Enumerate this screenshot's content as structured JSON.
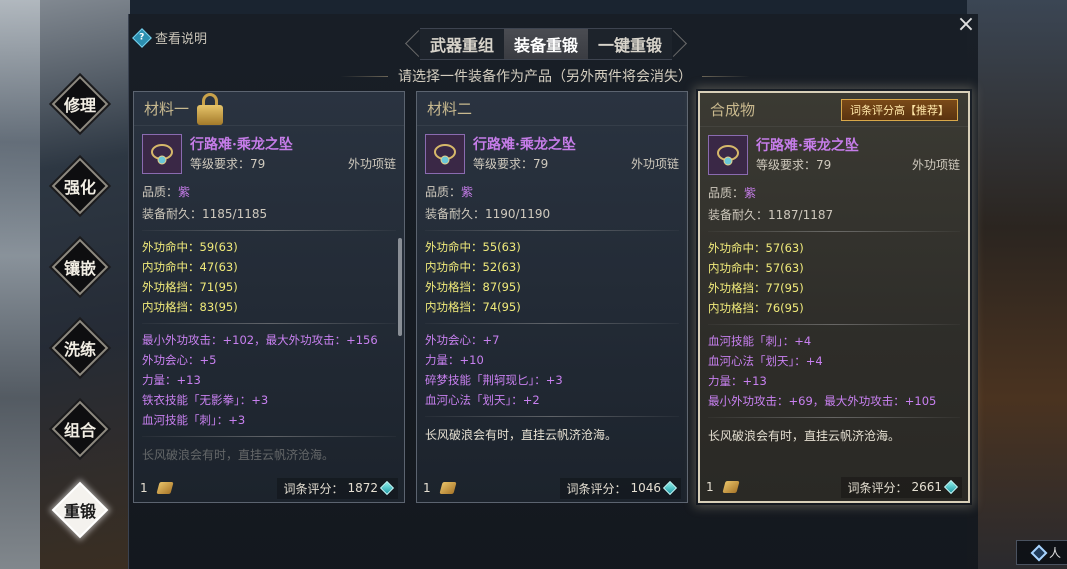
{
  "header": {
    "help_label": "查看说明",
    "close_symbol": "×",
    "subtitle": "请选择一件装备作为产品（另外两件将会消失）"
  },
  "tabs": [
    {
      "label": "武器重组",
      "active": false
    },
    {
      "label": "装备重锻",
      "active": true
    },
    {
      "label": "一键重锻",
      "active": false
    }
  ],
  "side_menu": [
    {
      "label": "修理",
      "active": false
    },
    {
      "label": "强化",
      "active": false
    },
    {
      "label": "镶嵌",
      "active": false
    },
    {
      "label": "洗练",
      "active": false
    },
    {
      "label": "组合",
      "active": false
    },
    {
      "label": "重锻",
      "active": true
    }
  ],
  "cards": [
    {
      "title": "材料一",
      "locked": true,
      "item_name": "行路难·乘龙之坠",
      "level_req": "等级要求：79",
      "item_type": "外功项链",
      "quality_label": "品质：",
      "quality_value": "紫",
      "durability": "装备耐久：1185/1185",
      "stats": [
        "外功命中：59(63)",
        "内功命中：47(63)",
        "外功格挡：71(95)",
        "内功格挡：83(95)"
      ],
      "affixes": [
        "最小外功攻击：+102，最大外功攻击：+156",
        "外功会心：+5",
        "力量：+13",
        "铁衣技能「无影拳」：+3",
        "血河技能「刺」：+3"
      ],
      "flavor": "长风破浪会有时，直挂云帆济沧海。",
      "count": "1",
      "score_label": "词条评分：",
      "score": "1872"
    },
    {
      "title": "材料二",
      "locked": false,
      "item_name": "行路难·乘龙之坠",
      "level_req": "等级要求：79",
      "item_type": "外功项链",
      "quality_label": "品质：",
      "quality_value": "紫",
      "durability": "装备耐久：1190/1190",
      "stats": [
        "外功命中：55(63)",
        "内功命中：52(63)",
        "外功格挡：87(95)",
        "内功格挡：74(95)"
      ],
      "affixes": [
        "外功会心：+7",
        "力量：+10",
        "碎梦技能「荆轲现匕」：+3",
        "血河心法「划天」：+2"
      ],
      "flavor": "长风破浪会有时，直挂云帆济沧海。",
      "count": "1",
      "score_label": "词条评分：",
      "score": "1046"
    },
    {
      "title": "合成物",
      "badge": "词条评分高【推荐】",
      "locked": false,
      "item_name": "行路难·乘龙之坠",
      "level_req": "等级要求：79",
      "item_type": "外功项链",
      "quality_label": "品质：",
      "quality_value": "紫",
      "durability": "装备耐久：1187/1187",
      "stats": [
        "外功命中：57(63)",
        "内功命中：57(63)",
        "外功格挡：77(95)",
        "内功格挡：76(95)"
      ],
      "affixes": [
        "血河技能「刺」：+4",
        "血河心法「划天」：+4",
        "力量：+13",
        "最小外功攻击：+69，最大外功攻击：+105"
      ],
      "flavor": "长风破浪会有时，直挂云帆济沧海。",
      "count": "1",
      "score_label": "词条评分：",
      "score": "2661"
    }
  ],
  "corner": {
    "label": "人"
  },
  "colors": {
    "quality_purple": "#c57ce8",
    "stat_yellow": "#f0ea7a",
    "affix_purple": "#c880f0",
    "score_gem": "#1f9aa6"
  }
}
